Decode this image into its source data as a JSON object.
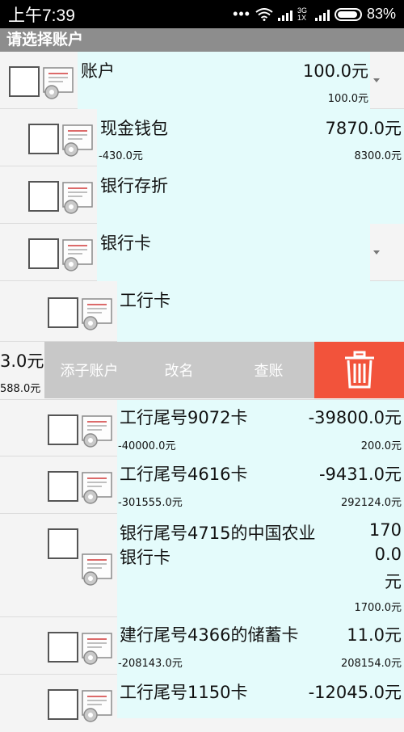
{
  "status": {
    "time": "上午7:39",
    "battery": "83%",
    "network": "3G 1X"
  },
  "title": "请选择账户",
  "rows": [
    {
      "name": "账户",
      "amount": "100.0元",
      "sub_left": "",
      "sub_right": "100.0元"
    },
    {
      "name": "现金钱包",
      "amount": "7870.0元",
      "sub_left": "-430.0元",
      "sub_right": "8300.0元"
    },
    {
      "name": "银行存折",
      "amount": "",
      "sub_left": "",
      "sub_right": ""
    },
    {
      "name": "银行卡",
      "amount": "",
      "sub_left": "",
      "sub_right": ""
    },
    {
      "name": "工行卡",
      "amount": "",
      "sub_left": "",
      "sub_right": ""
    },
    {
      "name": "工行尾号9072卡",
      "amount": "-39800.0元",
      "sub_left": "-40000.0元",
      "sub_right": "200.0元"
    },
    {
      "name": "工行尾号4616卡",
      "amount": "-9431.0元",
      "sub_left": "-301555.0元",
      "sub_right": "292124.0元"
    },
    {
      "name_line1": "银行尾号4715的中国农业",
      "name_line2": "银行卡",
      "amount_line1": "170",
      "amount_line2": "0.0",
      "amount_line3": "元",
      "sub_right": "1700.0元"
    },
    {
      "name": "建行尾号4366的储蓄卡",
      "amount": "11.0元",
      "sub_left": "-208143.0元",
      "sub_right": "208154.0元"
    },
    {
      "name": "工行尾号1150卡",
      "amount": "-12045.0元",
      "sub_left": "",
      "sub_right": ""
    }
  ],
  "swiped": {
    "amount_fragment": "3.0元",
    "sub_fragment": "588.0元"
  },
  "actions": {
    "add_sub": "添子账户",
    "rename": "改名",
    "check": "查账"
  }
}
